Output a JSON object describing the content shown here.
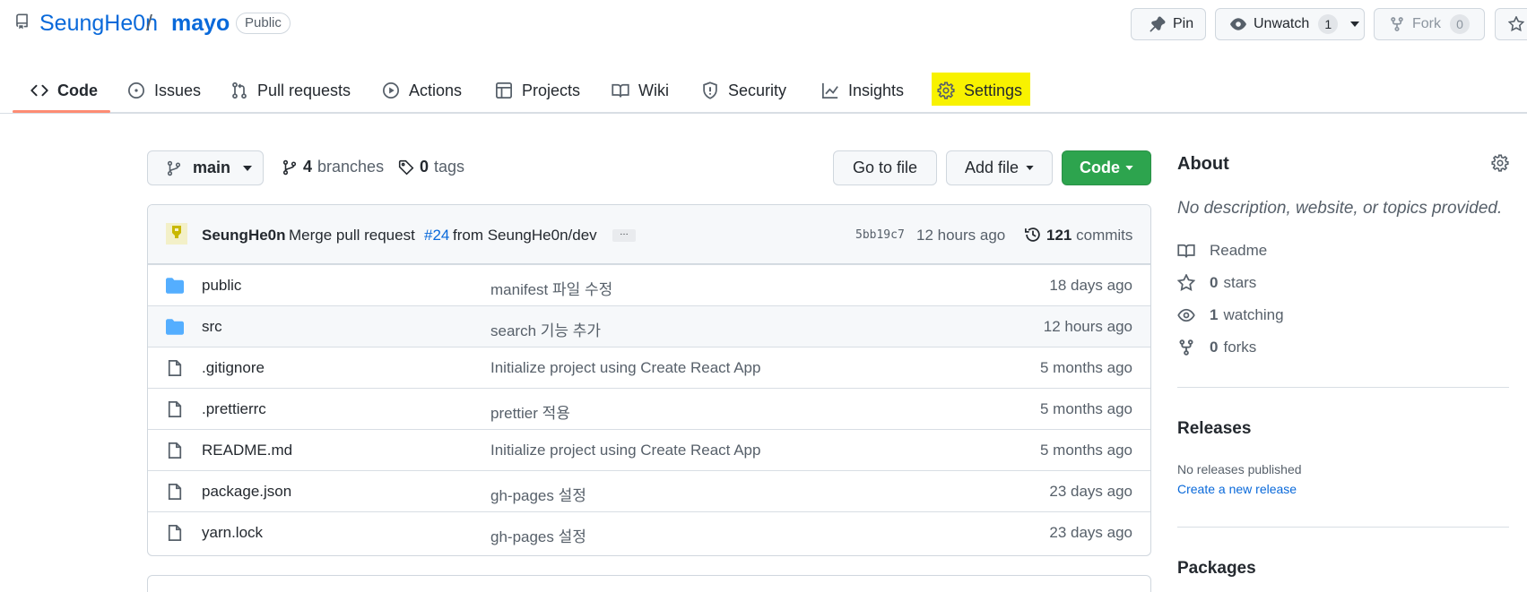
{
  "repo": {
    "owner": "SeungHe0n",
    "separator": "/",
    "name": "mayo",
    "visibility": "Public"
  },
  "actions": {
    "pin_label": "Pin",
    "watch_label": "Unwatch",
    "watch_count": "1",
    "fork_label": "Fork",
    "fork_count": "0"
  },
  "tabs": [
    {
      "label": "Code",
      "icon": "code-icon"
    },
    {
      "label": "Issues",
      "icon": "issue-icon"
    },
    {
      "label": "Pull requests",
      "icon": "pull-request-icon"
    },
    {
      "label": "Actions",
      "icon": "play-icon"
    },
    {
      "label": "Projects",
      "icon": "table-icon"
    },
    {
      "label": "Wiki",
      "icon": "book-icon"
    },
    {
      "label": "Security",
      "icon": "shield-icon"
    },
    {
      "label": "Insights",
      "icon": "graph-icon"
    },
    {
      "label": "Settings",
      "icon": "gear-icon"
    }
  ],
  "branch_bar": {
    "branch": "main",
    "branches_count": "4",
    "branches_label": "branches",
    "tags_count": "0",
    "tags_label": "tags",
    "goto_label": "Go to file",
    "addfile_label": "Add file",
    "code_label": "Code"
  },
  "latest_commit": {
    "author": "SeungHe0n",
    "message": "Merge pull request",
    "pr": "#24",
    "from": "from SeungHe0n/dev",
    "ellipsis": "…",
    "hash": "5bb19c7",
    "time": "12 hours ago",
    "commits_count": "121",
    "commits_label": "commits"
  },
  "files": [
    {
      "type": "folder",
      "name": "public",
      "message": "manifest 파일 수정",
      "age": "18 days ago"
    },
    {
      "type": "folder",
      "name": "src",
      "message": "search 기능 추가",
      "age": "12 hours ago"
    },
    {
      "type": "file",
      "name": ".gitignore",
      "message": "Initialize project using Create React App",
      "age": "5 months ago"
    },
    {
      "type": "file",
      "name": ".prettierrc",
      "message": "prettier 적용",
      "age": "5 months ago"
    },
    {
      "type": "file",
      "name": "README.md",
      "message": "Initialize project using Create React App",
      "age": "5 months ago"
    },
    {
      "type": "file",
      "name": "package.json",
      "message": "gh-pages 설정",
      "age": "23 days ago"
    },
    {
      "type": "file",
      "name": "yarn.lock",
      "message": "gh-pages 설정",
      "age": "23 days ago"
    }
  ],
  "about": {
    "title": "About",
    "description": "No description, website, or topics provided.",
    "readme": "Readme",
    "stars_count": "0",
    "stars_label": "stars",
    "watching_count": "1",
    "watching_label": "watching",
    "forks_count": "0",
    "forks_label": "forks"
  },
  "releases": {
    "title": "Releases",
    "none": "No releases published",
    "create": "Create a new release"
  },
  "packages": {
    "title": "Packages"
  },
  "colors": {
    "link": "#0969da",
    "primary_button": "#2da44e",
    "active_tab_underline": "#fd8c73",
    "highlight": "#f8f200",
    "folder": "#54aeff"
  }
}
